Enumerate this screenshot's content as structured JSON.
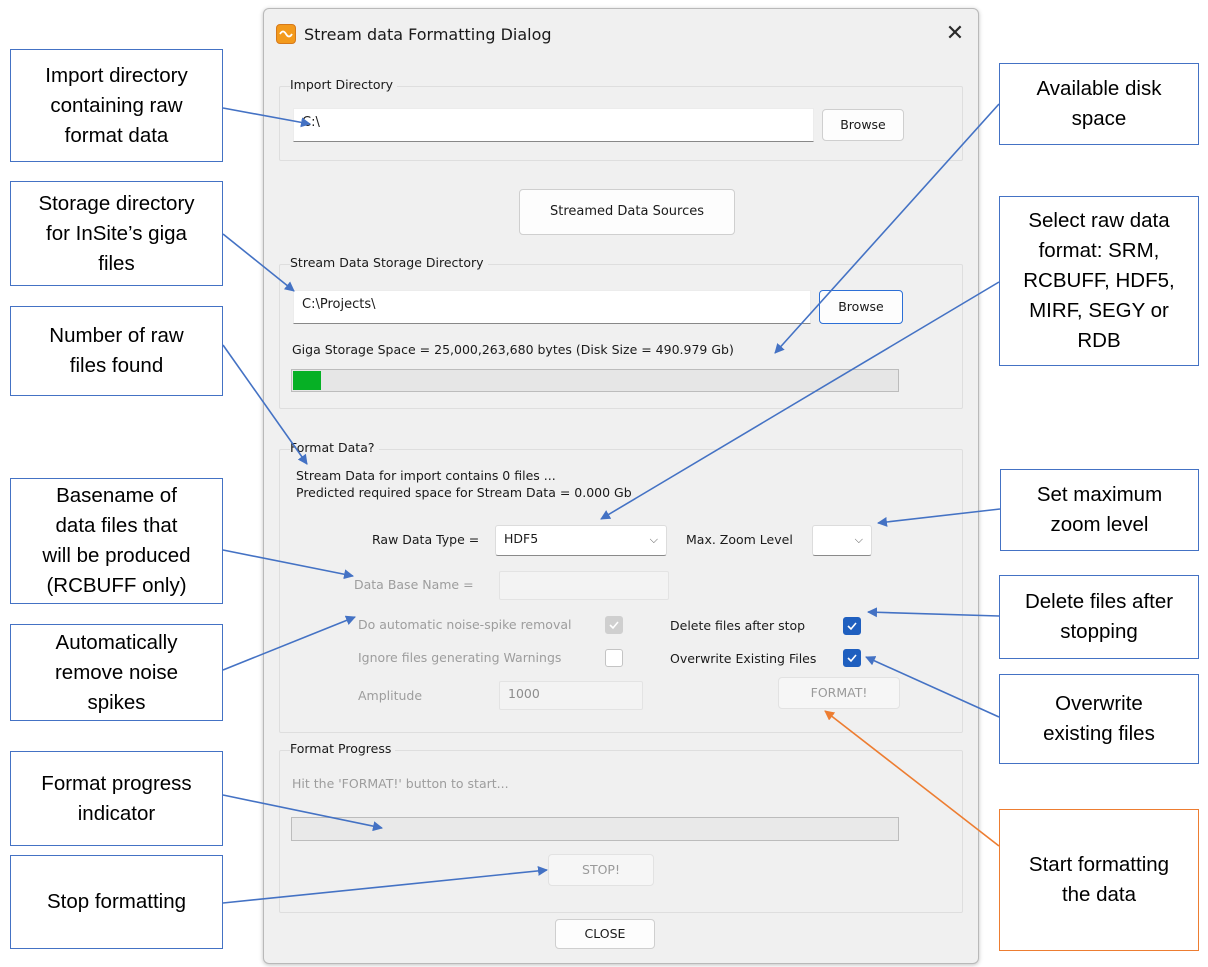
{
  "dialog": {
    "title": "Stream data Formatting Dialog",
    "close_glyph": "✕",
    "import_group": {
      "label": "Import Directory",
      "path_value": "C:\\",
      "browse_label": "Browse"
    },
    "streamed_sources_label": "Streamed Data Sources",
    "storage_group": {
      "label": "Stream Data Storage Directory",
      "path_value": "C:\\Projects\\",
      "browse_label": "Browse",
      "space_text": "Giga Storage Space = 25,000,263,680 bytes (Disk Size = 490.979 Gb)",
      "space_fraction": 0.05
    },
    "format_group": {
      "label": "Format Data?",
      "files_line": "Stream Data for import contains 0 files ...",
      "predicted_line": "Predicted required space for Stream Data =  0.000 Gb",
      "raw_type_label": "Raw Data Type =",
      "raw_type_value": "HDF5",
      "zoom_label": "Max. Zoom Level",
      "zoom_value": "",
      "basename_label": "Data Base Name =",
      "basename_value": "",
      "noise_label": "Do automatic noise-spike removal",
      "noise_checked": true,
      "delete_label": "Delete files after stop",
      "delete_checked": true,
      "ignore_label": "Ignore files generating Warnings",
      "ignore_checked": false,
      "overwrite_label": "Overwrite Existing Files",
      "overwrite_checked": true,
      "amplitude_label": "Amplitude",
      "amplitude_value": "1000",
      "format_button": "FORMAT!"
    },
    "progress_group": {
      "label": "Format Progress",
      "hint": "Hit the 'FORMAT!' button to start...",
      "progress_fraction": 0,
      "stop_button": "STOP!"
    },
    "close_button": "CLOSE"
  },
  "callouts": {
    "import_dir": [
      "Import directory",
      "containing raw",
      "format data"
    ],
    "storage_dir": [
      "Storage directory",
      "for InSite’s giga",
      "files"
    ],
    "raw_files": [
      "Number of raw",
      "files found"
    ],
    "basename": [
      "Basename of",
      "data files that",
      "will be produced",
      "(RCBUFF only)"
    ],
    "noise": [
      "Automatically",
      "remove noise",
      "spikes"
    ],
    "progress_indicator": [
      "Format progress",
      "indicator"
    ],
    "stop": [
      "Stop formatting"
    ],
    "disk_space": [
      "Available disk",
      "space"
    ],
    "raw_format": [
      "Select raw data",
      "format: SRM,",
      "RCBUFF, HDF5,",
      "MIRF, SEGY or",
      "RDB"
    ],
    "zoom": [
      "Set maximum",
      "zoom level"
    ],
    "delete": [
      "Delete files after",
      "stopping"
    ],
    "overwrite": [
      "Overwrite",
      "existing files"
    ],
    "start": [
      "Start formatting",
      "the data"
    ]
  },
  "colors": {
    "callout_border": "#4472c4",
    "callout_arrow_blue": "#4472c4",
    "callout_arrow_orange": "#ed7d31",
    "progress_green": "#06b025",
    "checkbox_blue": "#1f5fbf"
  }
}
